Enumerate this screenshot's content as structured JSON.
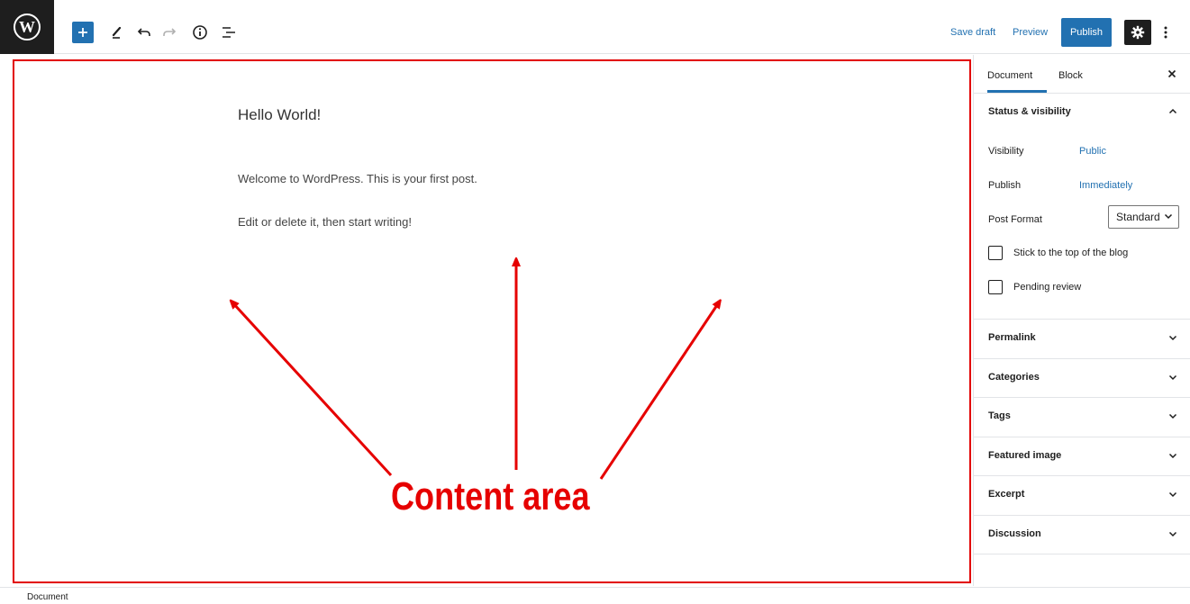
{
  "toolbar": {
    "save_draft": "Save draft",
    "preview": "Preview",
    "publish": "Publish",
    "icons": [
      "wordpress-logo",
      "plus",
      "pencil",
      "undo",
      "redo",
      "info",
      "list-view",
      "gear",
      "vertical-ellipsis"
    ]
  },
  "editor": {
    "title": "Hello World!",
    "paragraphs": [
      "Welcome to WordPress. This is your first post.",
      "Edit or delete it, then start writing!"
    ]
  },
  "annotation": {
    "label": "Content area",
    "color": "#e60000"
  },
  "sidebar": {
    "tabs": [
      {
        "label": "Document",
        "active": true
      },
      {
        "label": "Block",
        "active": false
      }
    ],
    "status": {
      "heading": "Status & visibility",
      "visibility_label": "Visibility",
      "visibility_value": "Public",
      "publish_label": "Publish",
      "publish_value": "Immediately",
      "post_format_label": "Post Format",
      "post_format_value": "Standard",
      "checkboxes": [
        {
          "label": "Stick to the top of the blog",
          "checked": false
        },
        {
          "label": "Pending review",
          "checked": false
        }
      ]
    },
    "panels": [
      "Permalink",
      "Categories",
      "Tags",
      "Featured image",
      "Excerpt",
      "Discussion"
    ]
  },
  "footer": {
    "breadcrumb": "Document"
  },
  "colors": {
    "accent": "#2271b1",
    "dark": "#1e1e1e",
    "annotation_red": "#e60000"
  }
}
